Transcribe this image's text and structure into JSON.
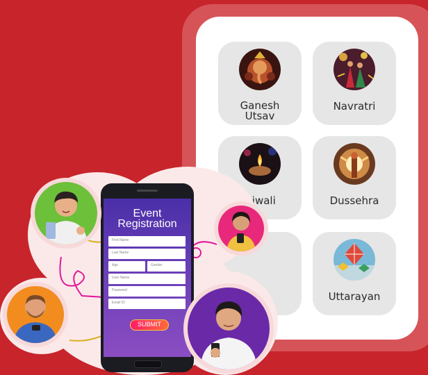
{
  "festivals": [
    {
      "label": "Ganesh\nUtsav",
      "line1": "Ganesh",
      "line2": "Utsav",
      "icon": "ganesh-idol-icon"
    },
    {
      "label": "Navratri",
      "icon": "navratri-dance-icon"
    },
    {
      "label": "Diwali",
      "icon": "diya-lamp-icon"
    },
    {
      "label": "Dussehra",
      "icon": "ravana-effigy-icon"
    },
    {
      "label": "",
      "icon": ""
    },
    {
      "label": "Uttarayan",
      "icon": "kite-icon"
    }
  ],
  "registration": {
    "title_line1": "Event",
    "title_line2": "Registration",
    "fields": {
      "first_name": "First Name",
      "last_name": "Last Name",
      "age": "Age",
      "gender": "Gender",
      "user_name": "User Name",
      "password": "Password",
      "email": "Email ID"
    },
    "submit_label": "SUBMIT"
  },
  "colors": {
    "background": "#c8242b",
    "panel": "#ffffff",
    "card": "#e6e6e6",
    "screen": "#5a35b0",
    "submit": "#ff2e63"
  }
}
